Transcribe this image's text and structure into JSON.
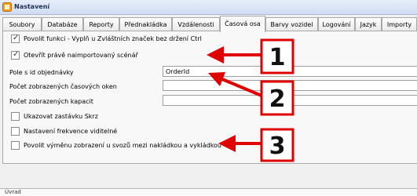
{
  "window": {
    "title": "Nastavení"
  },
  "tabs": [
    {
      "label": "Soubory"
    },
    {
      "label": "Databáze"
    },
    {
      "label": "Reporty"
    },
    {
      "label": "Přednakládka"
    },
    {
      "label": "Vzdálenosti"
    },
    {
      "label": "Časová osa"
    },
    {
      "label": "Barvy vozidel"
    },
    {
      "label": "Logování"
    },
    {
      "label": "Jazyk"
    },
    {
      "label": "Importy"
    }
  ],
  "active_tab": "Časová osa",
  "options": {
    "enable_function": {
      "label": "Povolit funkci - Vyplň u Zvláštních značek bez držení Ctrl",
      "checked": true
    },
    "open_imported": {
      "label": "Otevřít právě naimportovaný scénář",
      "checked": true
    },
    "order_id_field": {
      "label": "Pole s id objednávky",
      "value": "OrderId"
    },
    "time_windows_count": {
      "label": "Počet zobrazených časových oken",
      "value": ""
    },
    "capacity_count": {
      "label": "Počet zobrazených kapacit",
      "value": ""
    },
    "show_stop": {
      "label": "Ukazovat zastávku Skrz",
      "checked": false
    },
    "visibility_frequency": {
      "label": "Nastavení frekvence viditelné",
      "checked": false
    },
    "allow_swap": {
      "label": "Povolit výměnu zobrazení u svozů mezi nakládkou a vykládkou",
      "checked": false
    }
  },
  "bottom": {
    "text": "Úvrad"
  },
  "annotations": [
    {
      "number": "1"
    },
    {
      "number": "2"
    },
    {
      "number": "3"
    }
  ],
  "colors": {
    "arrow": "#e00000",
    "box_border": "#e00000"
  }
}
